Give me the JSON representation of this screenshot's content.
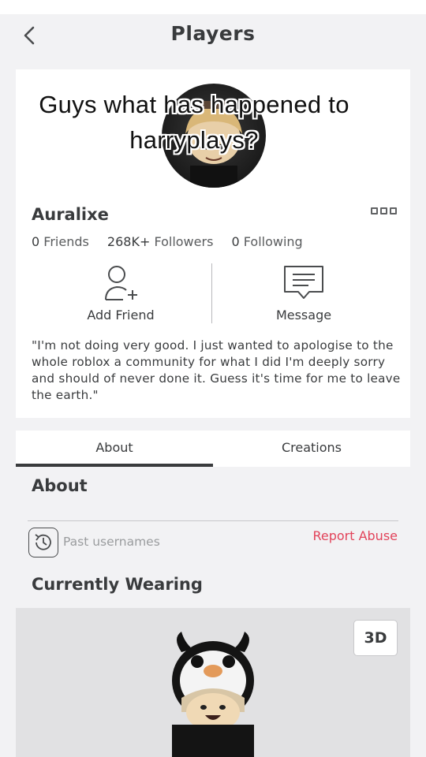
{
  "header": {
    "title": "Players"
  },
  "overlay": {
    "line1": "Guys what has happened to",
    "line2": "harryplays?"
  },
  "profile": {
    "username": "Auralixe",
    "stats": {
      "friends_count": "0",
      "friends_label": "Friends",
      "followers_count": "268K+",
      "followers_label": "Followers",
      "following_count": "0",
      "following_label": "Following"
    },
    "actions": {
      "add_friend": "Add Friend",
      "message": "Message"
    },
    "bio": "\"I'm not doing very good. I just wanted to apologise to the whole roblox a community for what I did I'm deeply sorry and should of never done it. Guess it's time for me to leave the earth.\""
  },
  "tabs": [
    {
      "label": "About",
      "active": true
    },
    {
      "label": "Creations",
      "active": false
    }
  ],
  "about": {
    "title": "About",
    "past_usernames": "Past usernames",
    "report_abuse": "Report Abuse"
  },
  "wearing": {
    "title": "Currently Wearing",
    "view_3d": "3D"
  },
  "colors": {
    "accent_red": "#e2435a",
    "text_dark": "#393b3d",
    "background": "#f2f2f4"
  }
}
